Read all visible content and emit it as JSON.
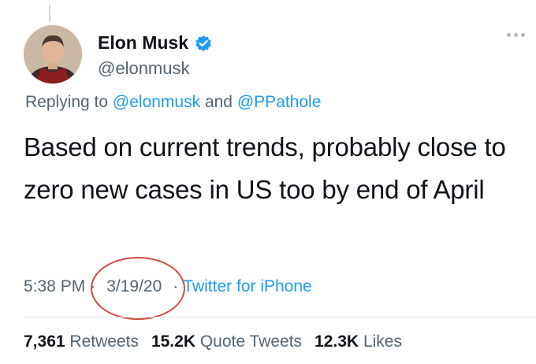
{
  "author": {
    "display_name": "Elon Musk",
    "handle": "@elonmusk",
    "verified": true
  },
  "reply_context": {
    "prefix": "Replying to",
    "mention_1": "@elonmusk",
    "connector": "and",
    "mention_2": "@PPathole"
  },
  "tweet": {
    "text": "Based on current trends, probably close to zero new cases in US too by end of April"
  },
  "meta": {
    "time": "5:38 PM",
    "separator": "·",
    "date": "3/19/20",
    "source": "Twitter for iPhone"
  },
  "stats": {
    "retweets_count": "7,361",
    "retweets_label": "Retweets",
    "quotes_count": "15.2K",
    "quotes_label": "Quote Tweets",
    "likes_count": "12.3K",
    "likes_label": "Likes"
  },
  "colors": {
    "link": "#1d9bf0",
    "secondary_text": "#536471",
    "annotation_circle": "#d04b3e",
    "verified_badge": "#1d9bf0"
  },
  "icons": {
    "verified": "verified-badge-icon",
    "more": "more-options-icon"
  }
}
